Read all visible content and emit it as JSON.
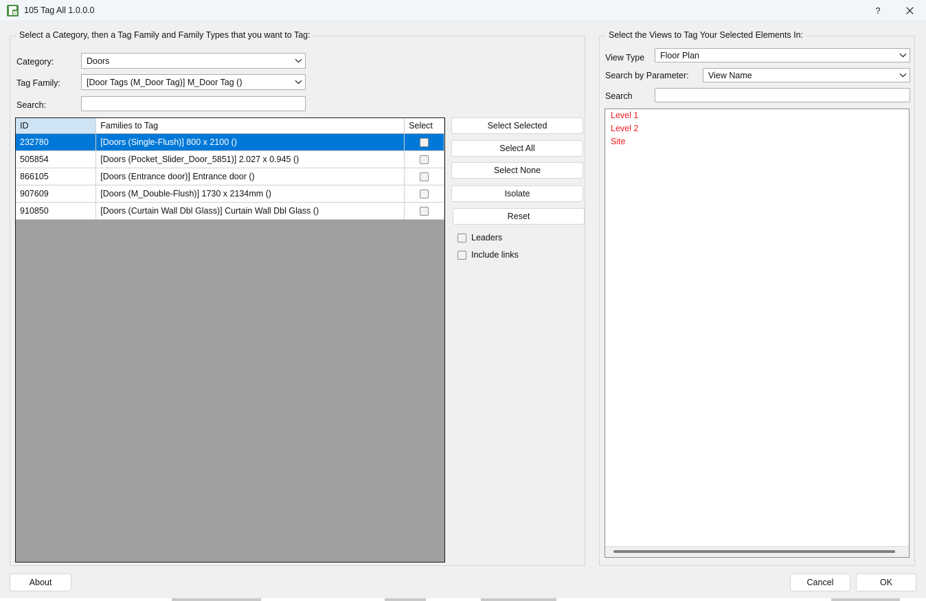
{
  "window": {
    "title": "105 Tag All 1.0.0.0",
    "icon": "app-icon",
    "help_label": "?",
    "close_label": "close-icon"
  },
  "left_panel": {
    "legend": "Select a Category, then a Tag Family and Family Types that you want to Tag:",
    "category_label": "Category:",
    "category_value": "Doors",
    "tag_family_label": "Tag Family:",
    "tag_family_value": "[Door Tags (M_Door Tag)] M_Door Tag ()",
    "search_label": "Search:",
    "search_value": "",
    "search_placeholder": ""
  },
  "grid": {
    "columns": [
      "ID",
      "Families to Tag",
      "Select"
    ],
    "rows": [
      {
        "id": "232780",
        "family": "[Doors (Single-Flush)] 800 x 2100 ()",
        "checked": false,
        "selected": true
      },
      {
        "id": "505854",
        "family": "[Doors (Pocket_Slider_Door_5851)] 2.027 x 0.945 ()",
        "checked": false,
        "selected": false
      },
      {
        "id": "866105",
        "family": "[Doors (Entrance door)] Entrance door ()",
        "checked": false,
        "selected": false
      },
      {
        "id": "907609",
        "family": "[Doors (M_Double-Flush)] 1730 x 2134mm ()",
        "checked": false,
        "selected": false
      },
      {
        "id": "910850",
        "family": "[Doors (Curtain Wall Dbl Glass)] Curtain Wall Dbl Glass ()",
        "checked": false,
        "selected": false
      }
    ]
  },
  "actions": {
    "select_selected": "Select Selected",
    "select_all": "Select All",
    "select_none": "Select None",
    "isolate": "Isolate",
    "reset": "Reset",
    "leaders_label": "Leaders",
    "leaders_checked": false,
    "include_links_label": "Include links",
    "include_links_checked": false
  },
  "right_panel": {
    "legend": "Select the Views to Tag Your Selected Elements In:",
    "view_type_label": "View Type",
    "view_type_value": "Floor Plan",
    "search_by_parameter_label": "Search by Parameter:",
    "search_by_parameter_value": "View Name",
    "search_label": "Search",
    "search_value": "",
    "search_placeholder": "",
    "views": [
      "Level 1",
      "Level 2",
      "Site"
    ]
  },
  "footer": {
    "about": "About",
    "cancel": "Cancel",
    "ok": "OK"
  },
  "colors": {
    "selection_blue": "#0078d7",
    "header_highlight": "#cfe4f5",
    "views_text_red": "#ee1c23",
    "grid_empty_grey": "#a0a0a0",
    "dialog_background": "#f0f0f0",
    "titlebar_background": "#f3f6f9"
  }
}
